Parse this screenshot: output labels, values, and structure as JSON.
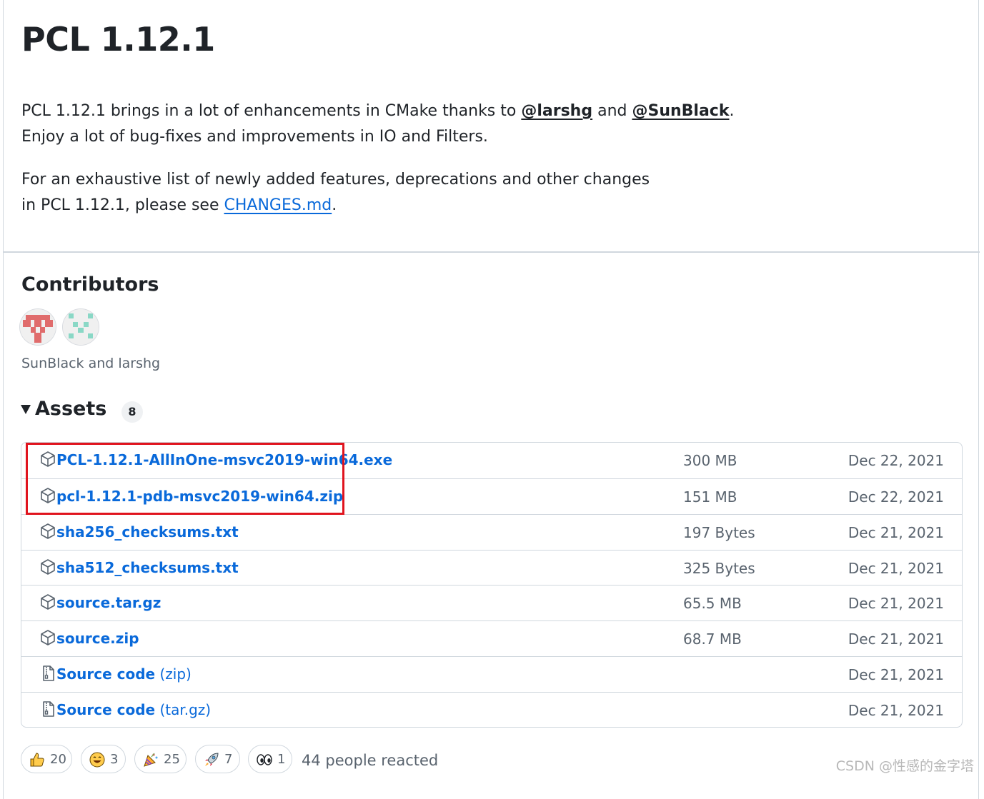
{
  "release": {
    "title": "PCL 1.12.1",
    "body": {
      "line1_prefix": "PCL 1.12.1 brings in a lot of enhancements in CMake thanks to ",
      "mention1": "@larshg",
      "and_text": " and ",
      "mention2": "@SunBlack",
      "line1_suffix": ".",
      "line2": "Enjoy a lot of bug-fixes and improvements in IO and Filters.",
      "para2_line1": "For an exhaustive list of newly added features, deprecations and other changes",
      "para2_line2_prefix": "in PCL 1.12.1, please see ",
      "changes_link": "CHANGES.md",
      "para2_suffix": "."
    }
  },
  "contributors": {
    "heading": "Contributors",
    "names": "SunBlack and larshg",
    "avatar_colors": [
      "#e06c6c",
      "#8ad8c6"
    ]
  },
  "assets": {
    "heading": "Assets",
    "count": "8",
    "items": [
      {
        "name": "PCL-1.12.1-AllInOne-msvc2019-win64.exe",
        "size": "300 MB",
        "date": "Dec 22, 2021",
        "icon": "package-icon"
      },
      {
        "name": "pcl-1.12.1-pdb-msvc2019-win64.zip",
        "size": "151 MB",
        "date": "Dec 22, 2021",
        "icon": "package-icon"
      },
      {
        "name": "sha256_checksums.txt",
        "size": "197 Bytes",
        "date": "Dec 21, 2021",
        "icon": "package-icon"
      },
      {
        "name": "sha512_checksums.txt",
        "size": "325 Bytes",
        "date": "Dec 21, 2021",
        "icon": "package-icon"
      },
      {
        "name": "source.tar.gz",
        "size": "65.5 MB",
        "date": "Dec 21, 2021",
        "icon": "package-icon"
      },
      {
        "name": "source.zip",
        "size": "68.7 MB",
        "date": "Dec 21, 2021",
        "icon": "package-icon"
      },
      {
        "name": "Source code",
        "ext": "(zip)",
        "size": "",
        "date": "Dec 21, 2021",
        "icon": "file-zip-icon"
      },
      {
        "name": "Source code",
        "ext": "(tar.gz)",
        "size": "",
        "date": "Dec 21, 2021",
        "icon": "file-zip-icon"
      }
    ]
  },
  "reactions": {
    "items": [
      {
        "icon": "thumbs-up-icon",
        "count": "20"
      },
      {
        "icon": "smile-icon",
        "count": "3"
      },
      {
        "icon": "tada-icon",
        "count": "25"
      },
      {
        "icon": "rocket-icon",
        "count": "7"
      },
      {
        "icon": "eyes-icon",
        "count": "1"
      }
    ],
    "summary": "44 people reacted"
  },
  "watermark": "CSDN @性感的金字塔",
  "colors": {
    "link": "#0969da",
    "muted": "#59636e",
    "border": "#d0d7de",
    "highlight": "#e0141e"
  }
}
